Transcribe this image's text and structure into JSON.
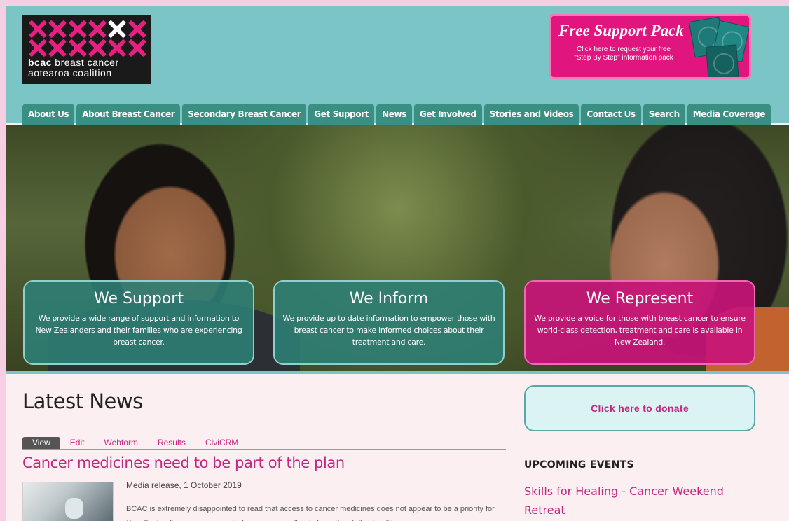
{
  "logo": {
    "line1_bold": "bcac",
    "line1_rest": " breast cancer",
    "line2": "aotearoa coalition"
  },
  "support_pack": {
    "title": "Free Support Pack",
    "subtitle_line1": "Click here to request your free",
    "subtitle_line2": "\"Step By Step\" information pack"
  },
  "nav": [
    "About Us",
    "About Breast Cancer",
    "Secondary Breast Cancer",
    "Get Support",
    "News",
    "Get Involved",
    "Stories and Videos",
    "Contact Us",
    "Search",
    "Media Coverage"
  ],
  "cards": [
    {
      "title": "We Support",
      "text": "We provide a wide range of support and information to New Zealanders and their families who are experiencing breast cancer."
    },
    {
      "title": "We Inform",
      "text": "We provide up to date information to empower those with breast cancer to make informed choices about their treatment and care."
    },
    {
      "title": "We Represent",
      "text": "We provide a voice for those with breast cancer to ensure world-class detection, treatment and care is available in New Zealand."
    }
  ],
  "main": {
    "heading": "Latest News",
    "tabs": [
      "View",
      "Edit",
      "Webform",
      "Results",
      "CiviCRM"
    ],
    "article": {
      "title": "Cancer medicines need to be part of the plan",
      "meta": "Media release, 1 October 2019",
      "excerpt": "BCAC is extremely disappointed to read that access to cancer medicines does not appear to be a priority for New Zealand's new cancer control agency according to its national director, Diana"
    }
  },
  "sidebar": {
    "donate_label": "Click here to donate",
    "events_heading": "UPCOMING EVENTS",
    "event_title": "Skills for Healing - Cancer Weekend Retreat"
  },
  "colors": {
    "teal": "#7cc5c6",
    "nav_tab": "#3a8f83",
    "pink": "#c4277f",
    "magenta_card": "#c81478",
    "page_bg": "#fbeff1",
    "outer_bg": "#f7cfe4"
  }
}
